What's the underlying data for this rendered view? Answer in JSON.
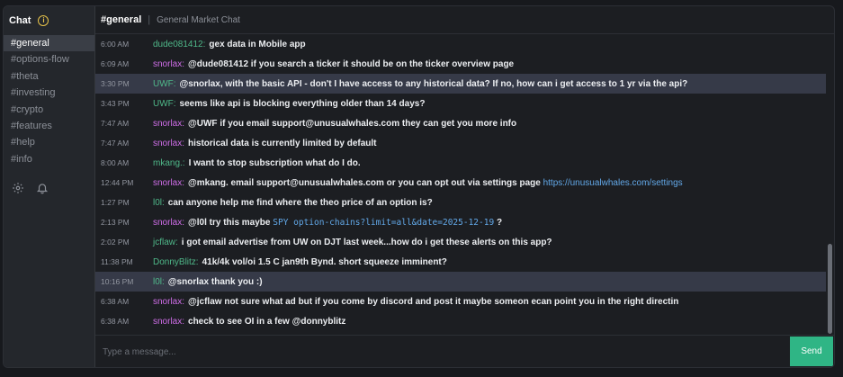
{
  "sidebar": {
    "title": "Chat",
    "info_icon": "info-icon",
    "channels": [
      "#general",
      "#options-flow",
      "#theta",
      "#investing",
      "#crypto",
      "#features",
      "#help",
      "#info"
    ],
    "active_channel": "#general",
    "footer_icons": [
      "gear-icon",
      "bell-icon"
    ]
  },
  "header": {
    "channel": "#general",
    "separator": "|",
    "description": "General Market Chat"
  },
  "messages": [
    {
      "time": "6:00 AM",
      "user": "dude081412:",
      "user_color": "green",
      "text": "gex data in Mobile app",
      "highlight": false
    },
    {
      "time": "6:09 AM",
      "user": "snorlax:",
      "user_color": "purple",
      "text": "@dude081412 if you search a ticker it should be on the ticker overview page",
      "highlight": false
    },
    {
      "time": "3:30 PM",
      "user": "UWF:",
      "user_color": "green",
      "text": "@snorlax, with the basic API - don't I have access to any historical data? If no, how can i get access to 1 yr via the api?",
      "highlight": true
    },
    {
      "time": "3:43 PM",
      "user": "UWF:",
      "user_color": "green",
      "text": "seems like api is blocking everything older than 14 days?",
      "highlight": false
    },
    {
      "time": "7:47 AM",
      "user": "snorlax:",
      "user_color": "purple",
      "text": "@UWF if you email support@unusualwhales.com they can get you more info",
      "highlight": false
    },
    {
      "time": "7:47 AM",
      "user": "snorlax:",
      "user_color": "purple",
      "text": "historical data is currently limited by default",
      "highlight": false
    },
    {
      "time": "8:00 AM",
      "user": "mkang.:",
      "user_color": "green",
      "text": "I want to stop subscription what do I do.",
      "highlight": false
    },
    {
      "time": "12:44 PM",
      "user": "snorlax:",
      "user_color": "purple",
      "text": "@mkang. email support@unusualwhales.com or you can opt out via settings page",
      "link": "https://unusualwhales.com/settings",
      "highlight": false
    },
    {
      "time": "1:27 PM",
      "user": "l0l:",
      "user_color": "green",
      "text": "can anyone help me find where the theo price of an option is?",
      "highlight": false
    },
    {
      "time": "2:13 PM",
      "user": "snorlax:",
      "user_color": "purple",
      "text": "@l0l try this maybe",
      "code": "SPY option-chains?limit=all&date=2025-12-19",
      "tail": "?",
      "highlight": false
    },
    {
      "time": "2:02 PM",
      "user": "jcflaw:",
      "user_color": "green",
      "text": "i got email advertise from UW on DJT last week...how do i get these alerts on this app?",
      "highlight": false
    },
    {
      "time": "11:38 PM",
      "user": "DonnyBlitz:",
      "user_color": "green",
      "text": "41k/4k vol/oi 1.5 C jan9th Bynd. short squeeze imminent?",
      "highlight": false
    },
    {
      "time": "10:16 PM",
      "user": "l0l:",
      "user_color": "green",
      "text": "@snorlax thank you :)",
      "highlight": true
    },
    {
      "time": "6:38 AM",
      "user": "snorlax:",
      "user_color": "purple",
      "text": "@jcflaw not sure what ad but if you come by discord and post it maybe someon ecan point you in the right directin",
      "highlight": false
    },
    {
      "time": "6:38 AM",
      "user": "snorlax:",
      "user_color": "purple",
      "text": "check to see OI in a few @donnyblitz",
      "highlight": false
    }
  ],
  "composer": {
    "placeholder": "Type a message...",
    "value": "",
    "send_label": "Send"
  },
  "colors": {
    "accent_send": "#2fb585",
    "user_purple": "#cf6ee8",
    "user_green": "#4fb889",
    "link": "#62a8e8",
    "highlight_row": "#363a48"
  }
}
